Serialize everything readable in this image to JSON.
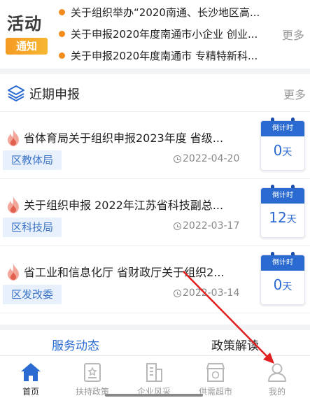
{
  "notice": {
    "logo_text": "活动",
    "logo_tag": "通知",
    "items": [
      "关于组织举办“2020南通、长沙地区高...",
      "关于申报2020年度南通市小企业 创业...",
      "关于申报2020年度南通市 专精特新科..."
    ],
    "more": "更多"
  },
  "recent": {
    "title": "近期申报",
    "more": "更多",
    "items": [
      {
        "title": "省体育局关于组织申报2023年度 省级...",
        "org": "区教体局",
        "date": "2022-04-20",
        "countdown_label": "倒计时",
        "days": "0",
        "unit": "天"
      },
      {
        "title": "关于组织申报 2022年江苏省科技副总...",
        "org": "区科技局",
        "date": "2022-03-17",
        "countdown_label": "倒计时",
        "days": "12",
        "unit": "天"
      },
      {
        "title": "省工业和信息化厅 省财政厅关于组织2...",
        "org": "区发改委",
        "date": "2022-03-14",
        "countdown_label": "倒计时",
        "days": "0",
        "unit": "天"
      }
    ]
  },
  "tabs": {
    "active": "服务动态",
    "inactive": "政策解读"
  },
  "bottom_nav": [
    {
      "label": "首页",
      "icon": "home-icon",
      "active": true
    },
    {
      "label": "扶持政策",
      "icon": "policy-icon",
      "active": false
    },
    {
      "label": "企业风采",
      "icon": "building-icon",
      "active": false
    },
    {
      "label": "供需超市",
      "icon": "market-icon",
      "active": false
    },
    {
      "label": "我的",
      "icon": "user-icon",
      "active": false
    }
  ],
  "colors": {
    "accent": "#2b6bd1",
    "notice_dot": "#f28c1e",
    "annotation_arrow": "#e02020"
  }
}
